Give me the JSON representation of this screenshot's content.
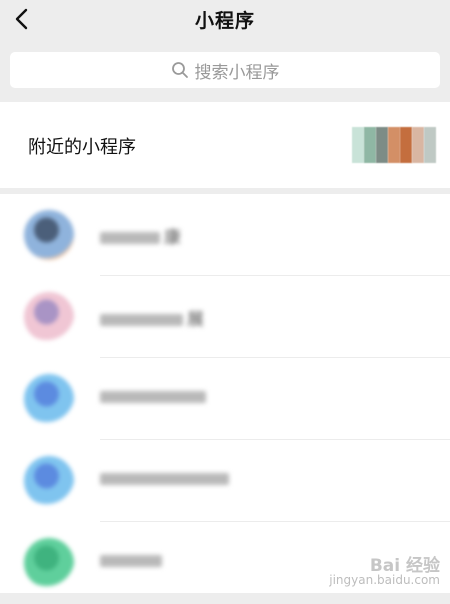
{
  "header": {
    "title": "小程序",
    "back_icon": "chevron-left-icon"
  },
  "search": {
    "placeholder": "搜索小程序",
    "icon": "search-icon"
  },
  "nearby": {
    "label": "附近的小程序",
    "thumbnail_colors": [
      "#c9e3d8",
      "#8fb7a4",
      "#7d8c86",
      "#d38f66",
      "#c46e3e",
      "#d9b6a2",
      "#bfc9c4"
    ]
  },
  "items": [
    {
      "name": "康",
      "avatar_colors": [
        "#8fb3dc",
        "#4b5f7a",
        "#f3c8a6"
      ]
    },
    {
      "name": "展",
      "avatar_colors": [
        "#f0c6d4",
        "#a994c5",
        "#ffffff"
      ]
    },
    {
      "name": "",
      "avatar_colors": [
        "#7fc4ef",
        "#5c8be0",
        "#ffffff"
      ]
    },
    {
      "name": "",
      "avatar_colors": [
        "#7fc4ef",
        "#5c8be0",
        "#ffffff"
      ]
    },
    {
      "name": "",
      "avatar_colors": [
        "#5fcf9c",
        "#3fb37f",
        "#ffffff"
      ]
    }
  ],
  "watermark": {
    "brand": "Bai 经验",
    "sub": "jingyan.baidu.com"
  }
}
